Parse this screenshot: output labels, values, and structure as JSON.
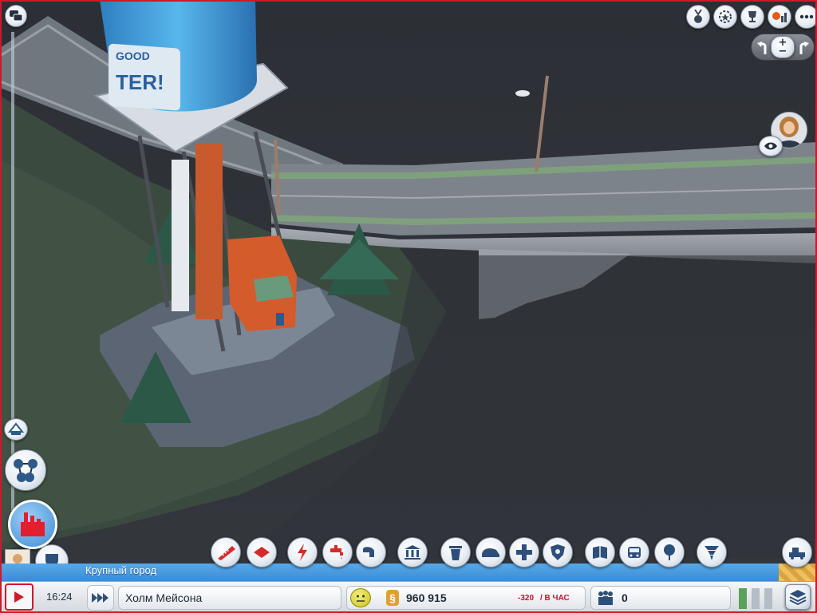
{
  "scene": {
    "tower_sign_top": "GOOD",
    "tower_sign_bottom": "TER!"
  },
  "top_right_buttons": [
    {
      "name": "achievements-medal-icon"
    },
    {
      "name": "wreath-icon"
    },
    {
      "name": "trophy-icon"
    },
    {
      "name": "leaderboard-icon"
    },
    {
      "name": "more-options-icon"
    }
  ],
  "camera": {
    "zoom_in": "+",
    "zoom_out": "−"
  },
  "left_panel": {
    "city_specialization_icon": "industry-icon",
    "region_icon": "region-network-icon",
    "data_maps_icon": "data-map-icon"
  },
  "toolbar": {
    "region_label": "Крупный город",
    "tools": [
      {
        "name": "roads-tool-icon"
      },
      {
        "name": "zoning-tool-icon"
      },
      {
        "name": "power-tool-icon"
      },
      {
        "name": "water-tool-icon"
      },
      {
        "name": "sewage-tool-icon"
      },
      {
        "name": "government-tool-icon"
      },
      {
        "name": "garbage-tool-icon"
      },
      {
        "name": "fire-tool-icon"
      },
      {
        "name": "health-tool-icon"
      },
      {
        "name": "police-tool-icon"
      },
      {
        "name": "education-tool-icon"
      },
      {
        "name": "transport-tool-icon"
      },
      {
        "name": "parks-tool-icon"
      },
      {
        "name": "disaster-tool-icon"
      },
      {
        "name": "great-works-tool-icon"
      }
    ]
  },
  "status": {
    "time": "16:24",
    "speed_icon": "fast-forward-icon",
    "city_name": "Холм Мейсона",
    "mood_icon": "neutral-face-icon",
    "money": "960 915",
    "income": "-320",
    "income_unit": "/ В ЧАС",
    "population": "0",
    "colors": {
      "money_negative": "#c8102e",
      "accent_blue": "#3d8bd3",
      "frame_red": "#d0182a"
    }
  }
}
